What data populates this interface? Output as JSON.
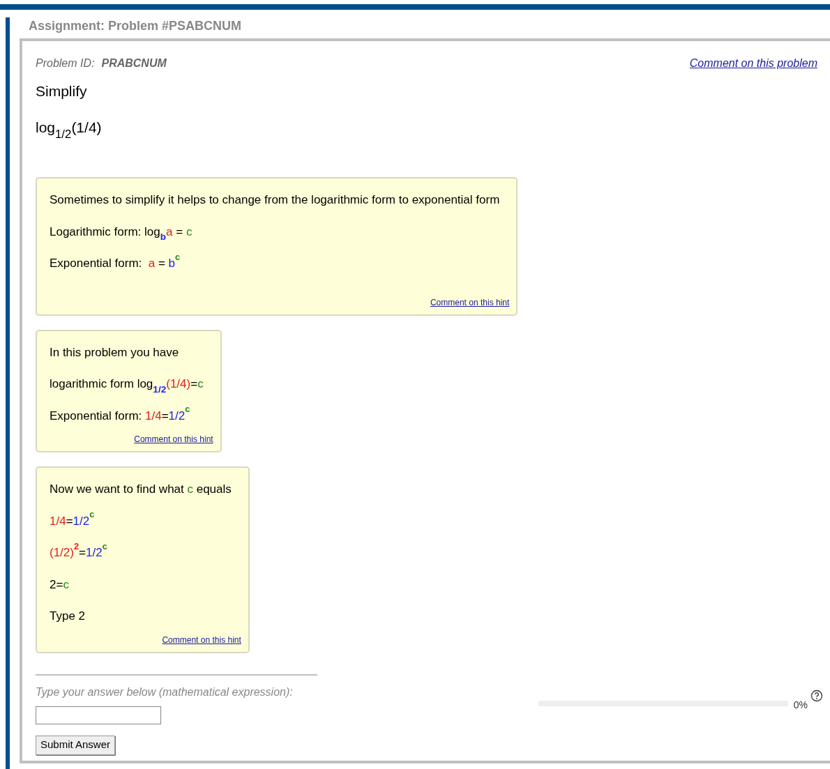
{
  "header": {
    "title": "Assignment: Problem #PSABCNUM"
  },
  "problem": {
    "id_label": "Problem ID:",
    "id": "PRABCNUM",
    "comment_link": "Comment on this problem",
    "instruction": "Simplify",
    "expression": [
      {
        "text": "log",
        "kind": "text",
        "color": "#000000"
      },
      {
        "text": "1/2",
        "kind": "sub",
        "color": "#000000"
      },
      {
        "text": "(1/4)",
        "kind": "text",
        "color": "#000000"
      }
    ]
  },
  "hints": [
    {
      "lines": [
        [
          {
            "text": "Sometimes to simplify it helps to change from the logarithmic form to exponential form",
            "kind": "text",
            "color": "#000000"
          }
        ],
        [
          {
            "text": "Logarithmic form: log",
            "kind": "text",
            "color": "#000000"
          },
          {
            "text": "b",
            "kind": "sub",
            "color": "#2222ee"
          },
          {
            "text": "a",
            "kind": "text",
            "color": "#e02020"
          },
          {
            "text": " = ",
            "kind": "text",
            "color": "#000000"
          },
          {
            "text": "c",
            "kind": "text",
            "color": "#228822"
          }
        ],
        [
          {
            "text": "Exponential form:  ",
            "kind": "text",
            "color": "#000000"
          },
          {
            "text": "a",
            "kind": "text",
            "color": "#e02020"
          },
          {
            "text": " = ",
            "kind": "text",
            "color": "#000000"
          },
          {
            "text": "b",
            "kind": "text",
            "color": "#2222ee"
          },
          {
            "text": "c",
            "kind": "sup",
            "color": "#228822"
          }
        ]
      ],
      "comment_link": "Comment on this hint"
    },
    {
      "lines": [
        [
          {
            "text": "In this problem you have",
            "kind": "text",
            "color": "#000000"
          }
        ],
        [
          {
            "text": "logarithmic form log",
            "kind": "text",
            "color": "#000000"
          },
          {
            "text": "1/2",
            "kind": "sub",
            "color": "#2222ee"
          },
          {
            "text": "(1/4)",
            "kind": "text",
            "color": "#e02020"
          },
          {
            "text": "=",
            "kind": "text",
            "color": "#000000"
          },
          {
            "text": "c",
            "kind": "text",
            "color": "#228822"
          }
        ],
        [
          {
            "text": "Exponential form: ",
            "kind": "text",
            "color": "#000000"
          },
          {
            "text": "1/4",
            "kind": "text",
            "color": "#e02020"
          },
          {
            "text": "=",
            "kind": "text",
            "color": "#000000"
          },
          {
            "text": "1/2",
            "kind": "text",
            "color": "#2222ee"
          },
          {
            "text": "c",
            "kind": "sup",
            "color": "#228822"
          }
        ]
      ],
      "comment_link": "Comment on this hint"
    },
    {
      "lines": [
        [
          {
            "text": "Now we want to find what ",
            "kind": "text",
            "color": "#000000"
          },
          {
            "text": "c",
            "kind": "text",
            "color": "#228822"
          },
          {
            "text": " equals",
            "kind": "text",
            "color": "#000000"
          }
        ],
        [
          {
            "text": "1/4",
            "kind": "text",
            "color": "#e02020"
          },
          {
            "text": "=",
            "kind": "text",
            "color": "#000000"
          },
          {
            "text": "1/2",
            "kind": "text",
            "color": "#2222ee"
          },
          {
            "text": "c",
            "kind": "sup",
            "color": "#228822"
          }
        ],
        [
          {
            "text": "(1/2)",
            "kind": "text",
            "color": "#e02020"
          },
          {
            "text": "2",
            "kind": "sup",
            "color": "#e02020"
          },
          {
            "text": "=",
            "kind": "text",
            "color": "#000000"
          },
          {
            "text": "1/2",
            "kind": "text",
            "color": "#2222ee"
          },
          {
            "text": "c",
            "kind": "sup",
            "color": "#228822"
          }
        ],
        [
          {
            "text": "2=",
            "kind": "text",
            "color": "#000000"
          },
          {
            "text": "c",
            "kind": "text",
            "color": "#228822"
          }
        ],
        [
          {
            "text": "Type 2",
            "kind": "text",
            "color": "#000000"
          }
        ]
      ],
      "comment_link": "Comment on this hint"
    }
  ],
  "answer": {
    "prompt": "Type your answer below (mathematical expression):",
    "submit": "Submit Answer"
  },
  "progress": {
    "level": 0,
    "reading": "0%"
  }
}
